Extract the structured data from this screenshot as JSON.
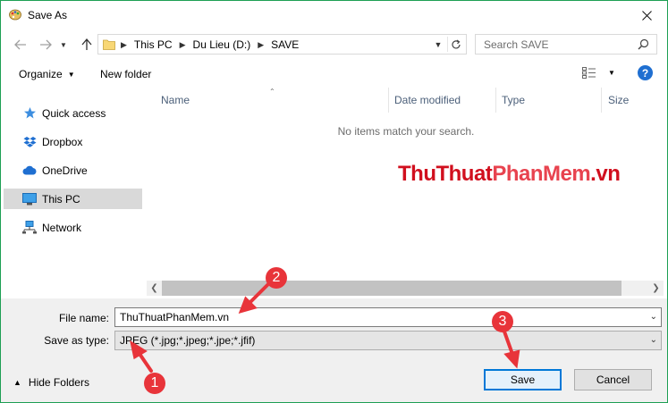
{
  "window": {
    "title": "Save As"
  },
  "address": {
    "crumbs": [
      "This PC",
      "Du Lieu (D:)",
      "SAVE"
    ]
  },
  "search": {
    "placeholder": "Search SAVE"
  },
  "toolbar": {
    "organize_label": "Organize",
    "new_folder_label": "New folder"
  },
  "sidebar": {
    "items": [
      {
        "label": "Quick access",
        "icon": "star-icon"
      },
      {
        "label": "Dropbox",
        "icon": "dropbox-icon"
      },
      {
        "label": "OneDrive",
        "icon": "cloud-icon"
      },
      {
        "label": "This PC",
        "icon": "monitor-icon",
        "selected": true
      },
      {
        "label": "Network",
        "icon": "network-icon"
      }
    ]
  },
  "columns": [
    "Name",
    "Date modified",
    "Type",
    "Size"
  ],
  "content": {
    "empty_message": "No items match your search."
  },
  "form": {
    "filename_label": "File name:",
    "filename_value": "ThuThuatPhanMem.vn",
    "filetype_label": "Save as type:",
    "filetype_value": "JPEG (*.jpg;*.jpeg;*.jpe;*.jfif)"
  },
  "footer": {
    "hide_folders_label": "Hide Folders",
    "save_label": "Save",
    "cancel_label": "Cancel"
  },
  "watermark": {
    "part1": "ThuThuat",
    "part2": "PhanMem",
    "part3": ".vn"
  },
  "annotations": [
    "1",
    "2",
    "3"
  ],
  "colors": {
    "accent": "#0078d7",
    "annotation": "#e8343a",
    "window_border": "#1e9f54",
    "selected": "#d9d9d9"
  }
}
